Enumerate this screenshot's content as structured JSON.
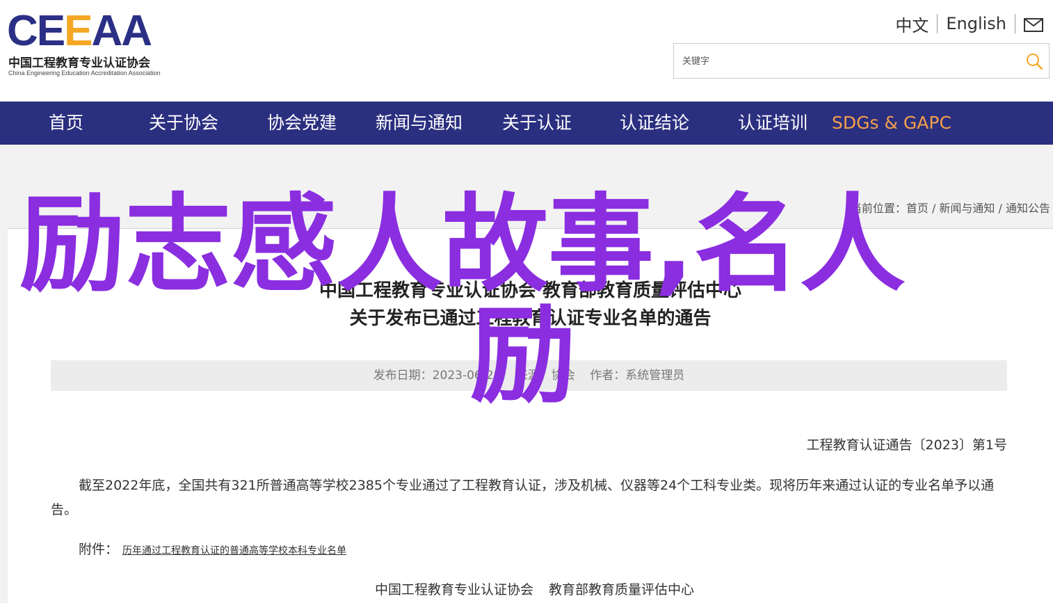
{
  "header": {
    "logo": {
      "mark_part1": "CE",
      "mark_accent": "E",
      "mark_part2": "AA",
      "name_cn": "中国工程教育专业认证协会",
      "name_en": "China Engineering Education Accreditation Association"
    },
    "lang": {
      "zh": "中文",
      "en": "English"
    },
    "search": {
      "placeholder": "关键字"
    }
  },
  "nav": {
    "items": [
      {
        "label": "首页"
      },
      {
        "label": "关于协会"
      },
      {
        "label": "协会党建"
      },
      {
        "label": "新闻与通知"
      },
      {
        "label": "关于认证"
      },
      {
        "label": "认证结论"
      },
      {
        "label": "认证培训"
      },
      {
        "label": "SDGs & GAPC"
      }
    ]
  },
  "breadcrumb": "当前位置：首页 / 新闻与通知 / 通知公告",
  "article": {
    "title_line1": "中国工程教育专业认证协会 教育部教育质量评估中心",
    "title_line2": "关于发布已通过工程教育认证专业名单的通告",
    "meta": {
      "date": "发布日期：2023-06-28",
      "source": "来源：协会",
      "author": "作者：系统管理员"
    },
    "doc_number": "工程教育认证通告〔2023〕第1号",
    "paragraph": "截至2022年底，全国共有321所普通高等学校2385个专业通过了工程教育认证，涉及机械、仪器等24个工科专业类。现将历年来通过认证的专业名单予以通告。",
    "attachment_label": "附件：",
    "attachment_link": "历年通过工程教育认证的普通高等学校本科专业名单",
    "signer1": "中国工程教育专业认证协会",
    "signer2": "教育部教育质量评估中心"
  },
  "overlay": {
    "line1": "励志感人故事,名人",
    "line2": "励",
    "color": "#8a2ee0"
  }
}
